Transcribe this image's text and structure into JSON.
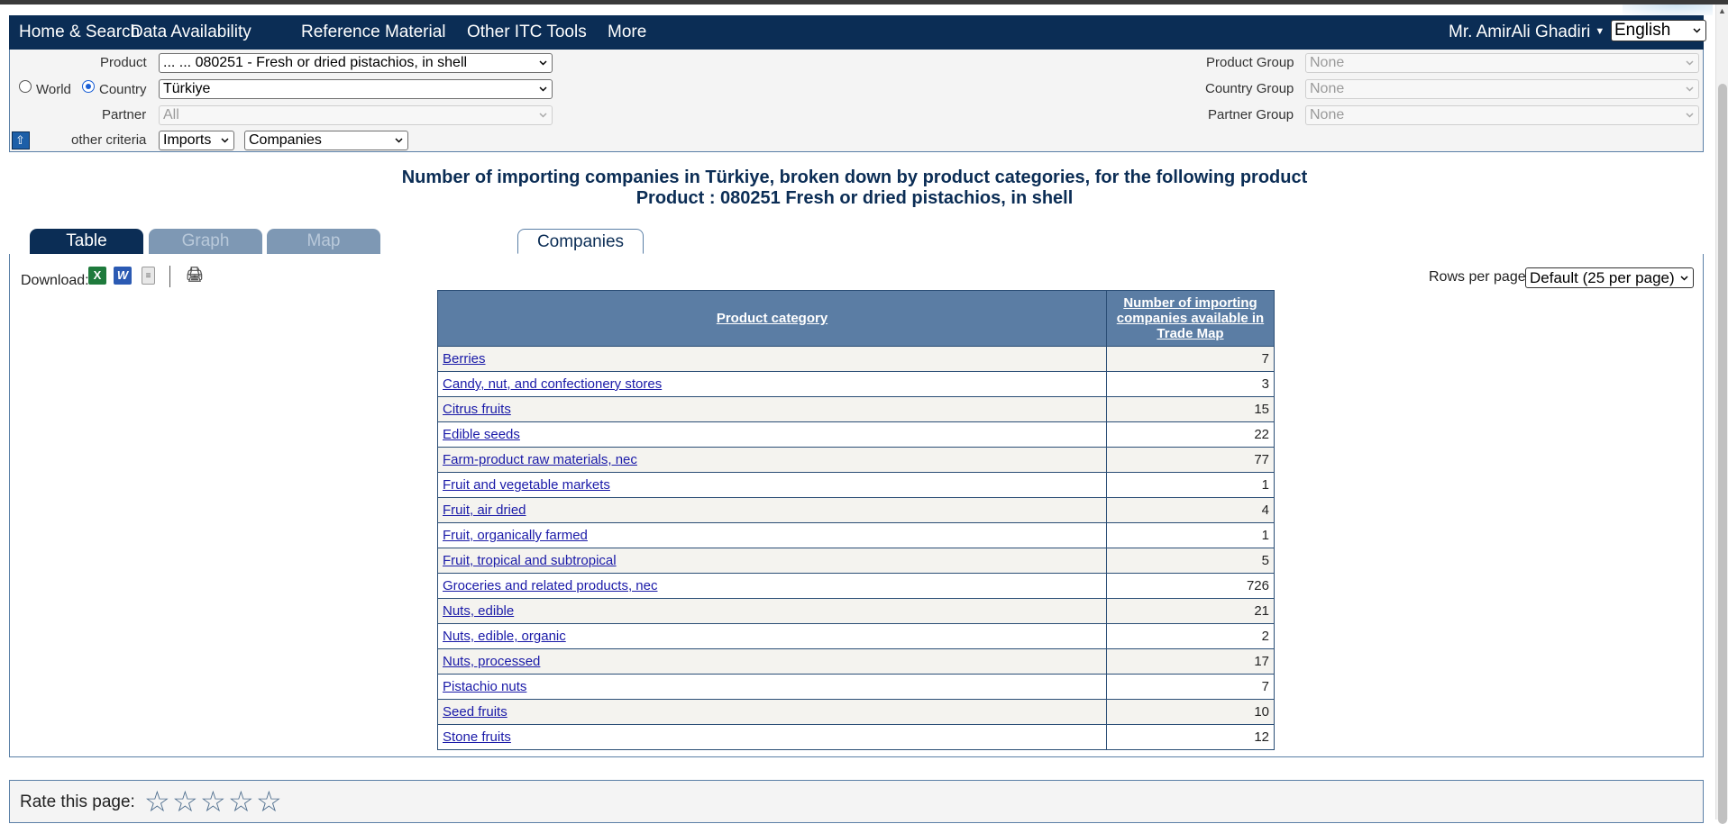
{
  "nav": {
    "items": [
      "Home & Search",
      "Data Availability",
      "Reference Material",
      "Other ITC Tools",
      "More"
    ],
    "user": "Mr. AmirAli Ghadiri",
    "language": "English"
  },
  "criteria": {
    "product_label": "Product",
    "product_value": "... ... 080251 - Fresh or dried pistachios, in shell",
    "world_label": "World",
    "country_label": "Country",
    "country_value": "Türkiye",
    "partner_label": "Partner",
    "partner_value": "All",
    "other_label": "other criteria",
    "flow_value": "Imports",
    "type_value": "Companies",
    "product_group_label": "Product Group",
    "product_group_value": "None",
    "country_group_label": "Country Group",
    "country_group_value": "None",
    "partner_group_label": "Partner Group",
    "partner_group_value": "None"
  },
  "title": {
    "line1": "Number of importing companies in Türkiye, broken down by product categories, for the following product",
    "line2": "Product : 080251 Fresh or dried pistachios, in shell"
  },
  "tabs": {
    "table": "Table",
    "graph": "Graph",
    "map": "Map",
    "companies": "Companies"
  },
  "toolbar": {
    "download_label": "Download:",
    "rows_label": "Rows per page",
    "rows_value": "Default (25 per page)",
    "excel_icon": "excel-icon",
    "word_icon": "word-icon",
    "text_icon": "text-file-icon",
    "print_icon": "print-icon"
  },
  "table": {
    "headers": [
      "Product category",
      "Number of importing companies available in Trade Map"
    ],
    "rows": [
      {
        "category": "Berries",
        "count": "7"
      },
      {
        "category": "Candy, nut, and confectionery stores",
        "count": "3"
      },
      {
        "category": "Citrus fruits",
        "count": "15"
      },
      {
        "category": "Edible seeds",
        "count": "22"
      },
      {
        "category": "Farm-product raw materials, nec",
        "count": "77"
      },
      {
        "category": "Fruit and vegetable markets",
        "count": "1"
      },
      {
        "category": "Fruit, air dried",
        "count": "4"
      },
      {
        "category": "Fruit, organically farmed",
        "count": "1"
      },
      {
        "category": "Fruit, tropical and subtropical",
        "count": "5"
      },
      {
        "category": "Groceries and related products, nec",
        "count": "726"
      },
      {
        "category": "Nuts, edible",
        "count": "21"
      },
      {
        "category": "Nuts, edible, organic",
        "count": "2"
      },
      {
        "category": "Nuts, processed",
        "count": "17"
      },
      {
        "category": "Pistachio nuts",
        "count": "7"
      },
      {
        "category": "Seed fruits",
        "count": "10"
      },
      {
        "category": "Stone fruits",
        "count": "12"
      }
    ]
  },
  "rating": {
    "label": "Rate this page:",
    "stars": 5,
    "selected": 0
  },
  "colors": {
    "nav_bg": "#0b2d55",
    "table_header_bg": "#5b7da4",
    "link": "#1a1aa8"
  }
}
